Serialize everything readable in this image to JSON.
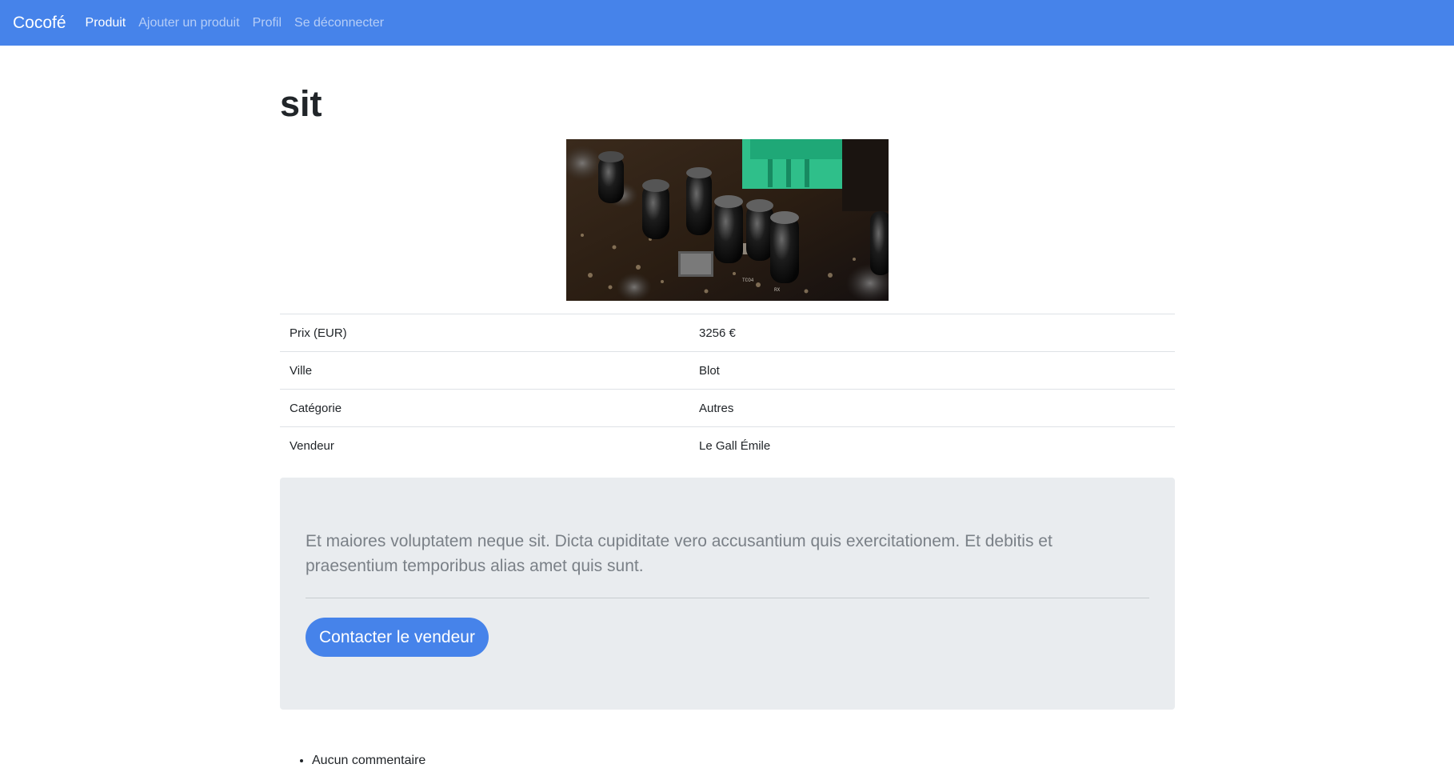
{
  "navbar": {
    "brand": "Cocofé",
    "links": [
      {
        "label": "Produit",
        "active": true
      },
      {
        "label": "Ajouter un produit",
        "active": false
      },
      {
        "label": "Profil",
        "active": false
      },
      {
        "label": "Se déconnecter",
        "active": false
      }
    ]
  },
  "product": {
    "title": "sit",
    "image_icon": "circuit-board-photo",
    "details": [
      {
        "label": "Prix (EUR)",
        "value": "3256 €"
      },
      {
        "label": "Ville",
        "value": "Blot"
      },
      {
        "label": "Catégorie",
        "value": "Autres"
      },
      {
        "label": "Vendeur",
        "value": "Le Gall Émile"
      }
    ],
    "description": "Et maiores voluptatem neque sit. Dicta cupiditate vero accusantium quis exercitationem. Et debitis et praesentium temporibus alias amet quis sunt.",
    "contact_button": "Contacter le vendeur"
  },
  "comments": [
    "Aucun commentaire"
  ],
  "colors": {
    "primary": "#4683ea",
    "jumbotron": "#e9ecef"
  }
}
